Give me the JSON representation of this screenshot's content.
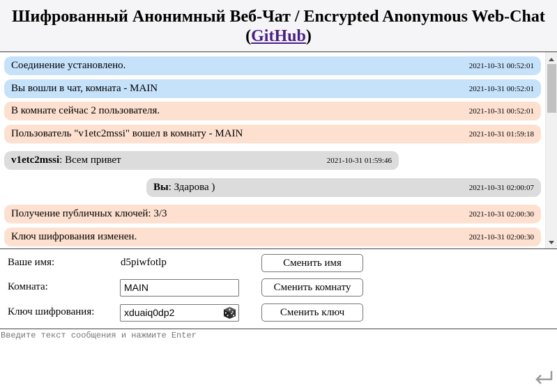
{
  "header": {
    "title": "Шифрованный Анонимный Веб-Чат / Encrypted Anonymous Web-Chat",
    "open_paren": "(",
    "github_link": "GitHub",
    "close_paren": ")"
  },
  "messages": [
    {
      "kind": "system",
      "author": "",
      "text": "Соединение установлено.",
      "time": "2021-10-31 00:52:01"
    },
    {
      "kind": "system",
      "author": "",
      "text": "Вы вошли в чат, комната - MAIN",
      "time": "2021-10-31 00:52:01"
    },
    {
      "kind": "info",
      "author": "",
      "text": "В комнате сейчас 2 пользователя.",
      "time": "2021-10-31 00:52:01"
    },
    {
      "kind": "info",
      "author": "",
      "text": "Пользователь \"v1etc2mssi\" вошел в комнату - MAIN",
      "time": "2021-10-31 01:59:18"
    },
    {
      "kind": "incoming",
      "author": "v1etc2mssi",
      "text": ": Всем привет",
      "time": "2021-10-31 01:59:46"
    },
    {
      "kind": "outgoing",
      "author": "Вы",
      "text": ": Здарова )",
      "time": "2021-10-31 02:00:07"
    },
    {
      "kind": "info",
      "author": "",
      "text": "Получение публичных ключей: 3/3",
      "time": "2021-10-31 02:00:30"
    },
    {
      "kind": "info",
      "author": "",
      "text": "Ключ шифрования изменен.",
      "time": "2021-10-31 02:00:30"
    }
  ],
  "controls": {
    "name_label": "Ваше имя:",
    "name_value": "d5piwfotlp",
    "change_name_button": "Сменить имя",
    "room_label": "Комната:",
    "room_value": "MAIN",
    "change_room_button": "Сменить комнату",
    "key_label": "Ключ шифрования:",
    "key_value": "xduaiq0dp2",
    "change_key_button": "Сменить ключ"
  },
  "composer": {
    "placeholder": "Введите текст сообщения и нажмите Enter"
  },
  "colors": {
    "system_bg": "#c6e2fb",
    "info_bg": "#fde0cf",
    "chat_bg": "#dcdcdc",
    "link": "#4b1f86"
  },
  "icons": {
    "random_key": "dice-icon",
    "send": "enter-arrow-icon"
  }
}
